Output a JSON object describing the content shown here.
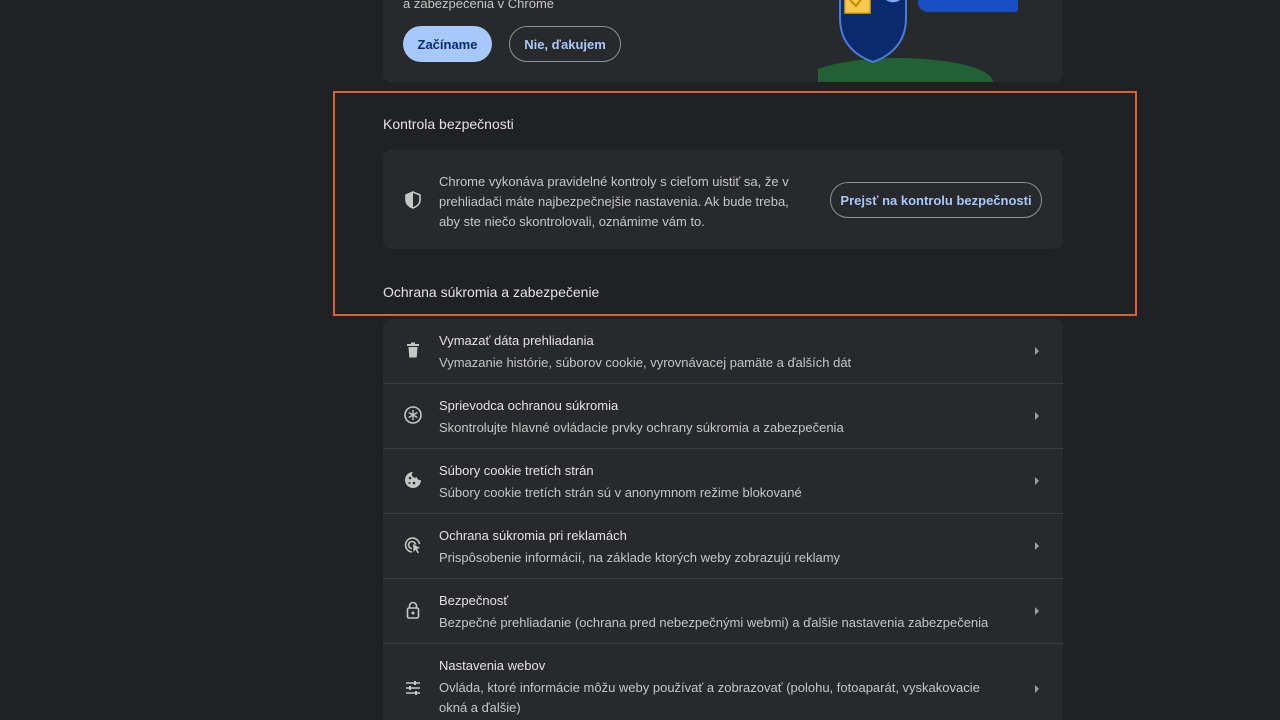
{
  "promo": {
    "text": "a zabezpečenia v Chrome",
    "start_button": "Začíname",
    "decline_button": "Nie, ďakujem"
  },
  "safety_check": {
    "title": "Kontrola bezpečnosti",
    "description": "Chrome vykonáva pravidelné kontroly s cieľom uistiť sa, že v prehliadači máte najbezpečnejšie nastavenia. Ak bude treba, aby ste niečo skontrolovali, oznámime vám to.",
    "button": "Prejsť na kontrolu bezpečnosti"
  },
  "privacy": {
    "title": "Ochrana súkromia a zabezpečenie",
    "items": [
      {
        "icon": "trash-icon",
        "title": "Vymazať dáta prehliadania",
        "subtitle": "Vymazanie histórie, súborov cookie, vyrovnávacej pamäte a ďalších dát"
      },
      {
        "icon": "compass-icon",
        "title": "Sprievodca ochranou súkromia",
        "subtitle": "Skontrolujte hlavné ovládacie prvky ochrany súkromia a zabezpečenia"
      },
      {
        "icon": "cookie-icon",
        "title": "Súbory cookie tretích strán",
        "subtitle": "Súbory cookie tretích strán sú v anonymnom režime blokované"
      },
      {
        "icon": "ad-privacy-icon",
        "title": "Ochrana súkromia pri reklamách",
        "subtitle": "Prispôsobenie informácií, na základe ktorých weby zobrazujú reklamy"
      },
      {
        "icon": "lock-icon",
        "title": "Bezpečnosť",
        "subtitle": "Bezpečné prehliadanie (ochrana pred nebezpečnými webmi) a ďalšie nastavenia zabezpečenia"
      },
      {
        "icon": "sliders-icon",
        "title": "Nastavenia webov",
        "subtitle": "Ovláda, ktoré informácie môžu weby používať a zobrazovať (polohu, fotoaparát, vyskakovacie okná a ďalšie)"
      }
    ]
  },
  "colors": {
    "background": "#202124",
    "card": "#28292c",
    "accent": "#a8c7fa",
    "highlight": "#d9623b"
  }
}
